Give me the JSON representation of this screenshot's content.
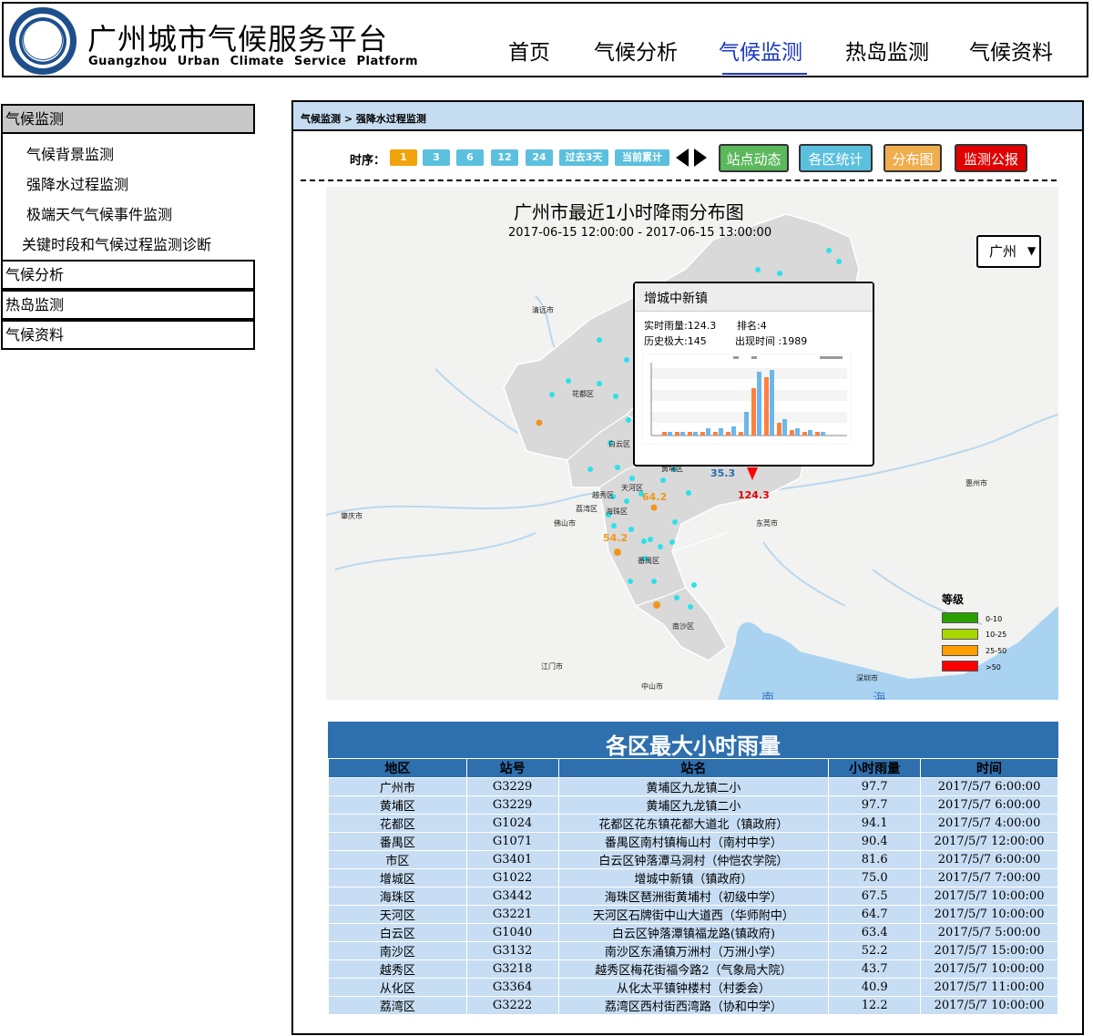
{
  "header": {
    "title": "广州城市气候服务平台",
    "subtitle": "Guangzhou Urban Climate Service Platform",
    "nav": [
      "首页",
      "气候分析",
      "气候监测",
      "热岛监测",
      "气候资料"
    ],
    "active_nav": "气候监测",
    "active_color": "#1a37c7"
  },
  "sidebar": {
    "sections": [
      {
        "label": "气候监测",
        "active": true,
        "items": [
          "气候背景监测",
          "强降水过程监测",
          "极端天气气候事件监测",
          "关键时段和气候过程监测诊断"
        ]
      },
      {
        "label": "气候分析"
      },
      {
        "label": "热岛监测"
      },
      {
        "label": "气候资料"
      }
    ]
  },
  "breadcrumb": {
    "parent": "气候监测",
    "separator": ">",
    "current": "强降水过程监测"
  },
  "toolbar": {
    "time_label": "时序：",
    "time_buttons": [
      "1",
      "3",
      "6",
      "12",
      "24",
      "过去3天",
      "当前累计"
    ],
    "active_time": "1",
    "prev_icon": "triangle-left-icon",
    "next_icon": "triangle-right-icon",
    "actions": [
      {
        "label": "站点动态",
        "color": "#5cb85c"
      },
      {
        "label": "各区统计",
        "color": "#5bc0de"
      },
      {
        "label": "分布图",
        "color": "#f0ad4e"
      },
      {
        "label": "监测公报",
        "color": "#e00000"
      }
    ]
  },
  "map": {
    "title": "广州市最近1小时降雨分布图",
    "time_range": "2017-06-15 12:00:00 -   2017-06-15 13:00:00",
    "city_select": "广州",
    "sea_label": "南 海",
    "places": [
      "清远市",
      "花都区",
      "白云区",
      "黄埔区",
      "天河区",
      "越秀区",
      "荔湾区",
      "海珠区",
      "佛山市",
      "番禺区",
      "南沙区",
      "江门市",
      "中山市",
      "东莞市",
      "深圳市",
      "惠州市",
      "肇庆市"
    ],
    "value_labels": [
      "35.3",
      "124.3",
      "64.2",
      "54.2"
    ],
    "legend": {
      "title": "等级",
      "items": [
        {
          "label": "0-10",
          "color": "#2aa000"
        },
        {
          "label": "10-25",
          "color": "#a8d800"
        },
        {
          "label": "25-50",
          "color": "#ff9e00"
        },
        {
          "label": ">50",
          "color": "#ff0000"
        }
      ]
    }
  },
  "popup": {
    "station": "增城中新镇",
    "realtime": "实时雨量:124.3",
    "rank": "排名:4",
    "hist_max": "历史极大:145",
    "year": "出现时间  :1989"
  },
  "table": {
    "caption": "各区最大小时雨量",
    "headers": [
      "地区",
      "站号",
      "站名",
      "小时雨量",
      "时间"
    ],
    "rows": [
      [
        "广州市",
        "G3229",
        "黄埔区九龙镇二小",
        "97.7",
        "2017/5/7 6:00:00"
      ],
      [
        "黄埔区",
        "G3229",
        "黄埔区九龙镇二小",
        "97.7",
        "2017/5/7 6:00:00"
      ],
      [
        "花都区",
        "G1024",
        "花都区花东镇花都大道北（镇政府）",
        "94.1",
        "2017/5/7 4:00:00"
      ],
      [
        "番禺区",
        "G1071",
        "番禺区南村镇梅山村（南村中学）",
        "90.4",
        "2017/5/7 12:00:00"
      ],
      [
        "市区",
        "G3401",
        "白云区钟落潭马洞村（仲恺农学院）",
        "81.6",
        "2017/5/7 6:00:00"
      ],
      [
        "增城区",
        "G1022",
        "增城中新镇（镇政府）",
        "75.0",
        "2017/5/7 7:00:00"
      ],
      [
        "海珠区",
        "G3442",
        "海珠区琶洲街黄埔村（初级中学）",
        "67.5",
        "2017/5/7 10:00:00"
      ],
      [
        "天河区",
        "G3221",
        "天河区石牌街中山大道西（华师附中）",
        "64.7",
        "2017/5/7 10:00:00"
      ],
      [
        "白云区",
        "G1040",
        "白云区钟落潭镇福龙路(镇政府)",
        "63.4",
        "2017/5/7 5:00:00"
      ],
      [
        "南沙区",
        "G3132",
        "南沙区东涌镇万洲村（万洲小学）",
        "52.2",
        "2017/5/7 15:00:00"
      ],
      [
        "越秀区",
        "G3218",
        "越秀区梅花街福今路2（气象局大院）",
        "43.7",
        "2017/5/7 10:00:00"
      ],
      [
        "从化区",
        "G3364",
        "从化太平镇钟楼村（村委会）",
        "40.9",
        "2017/5/7 11:00:00"
      ],
      [
        "荔湾区",
        "G3222",
        "荔湾区西村街西湾路（协和中学）",
        "12.2",
        "2017/5/7 10:00:00"
      ]
    ]
  }
}
